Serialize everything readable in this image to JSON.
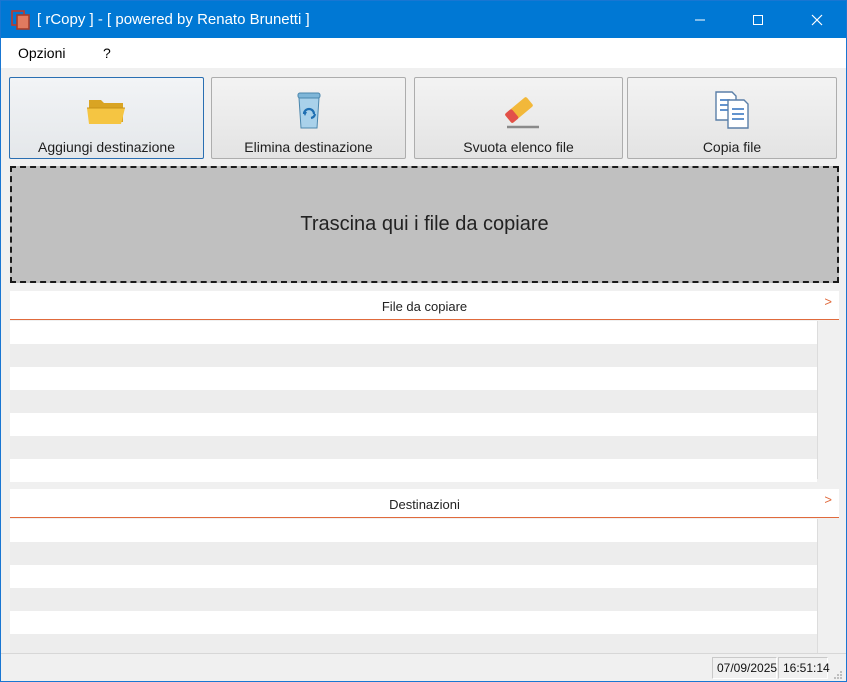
{
  "window": {
    "title": "[ rCopy ] - [ powered by Renato Brunetti ]",
    "icon": "copy-app-icon",
    "accent_color": "#0078d4"
  },
  "menu": {
    "items": [
      {
        "label": "Opzioni"
      },
      {
        "label": "?"
      }
    ]
  },
  "toolbar": {
    "buttons": [
      {
        "label": "Aggiungi destinazione",
        "icon": "folder-open-icon"
      },
      {
        "label": "Elimina destinazione",
        "icon": "recycle-bin-icon"
      },
      {
        "label": "Svuota elenco file",
        "icon": "eraser-icon"
      },
      {
        "label": "Copia file",
        "icon": "copy-documents-icon"
      }
    ]
  },
  "dropzone": {
    "text": "Trascina qui i file da copiare"
  },
  "files_panel": {
    "header": "File da copiare",
    "chevron": ">",
    "rows": []
  },
  "destinations_panel": {
    "header": "Destinazioni",
    "chevron": ">",
    "rows": []
  },
  "status": {
    "date": "07/09/2025",
    "time": "16:51:14"
  }
}
